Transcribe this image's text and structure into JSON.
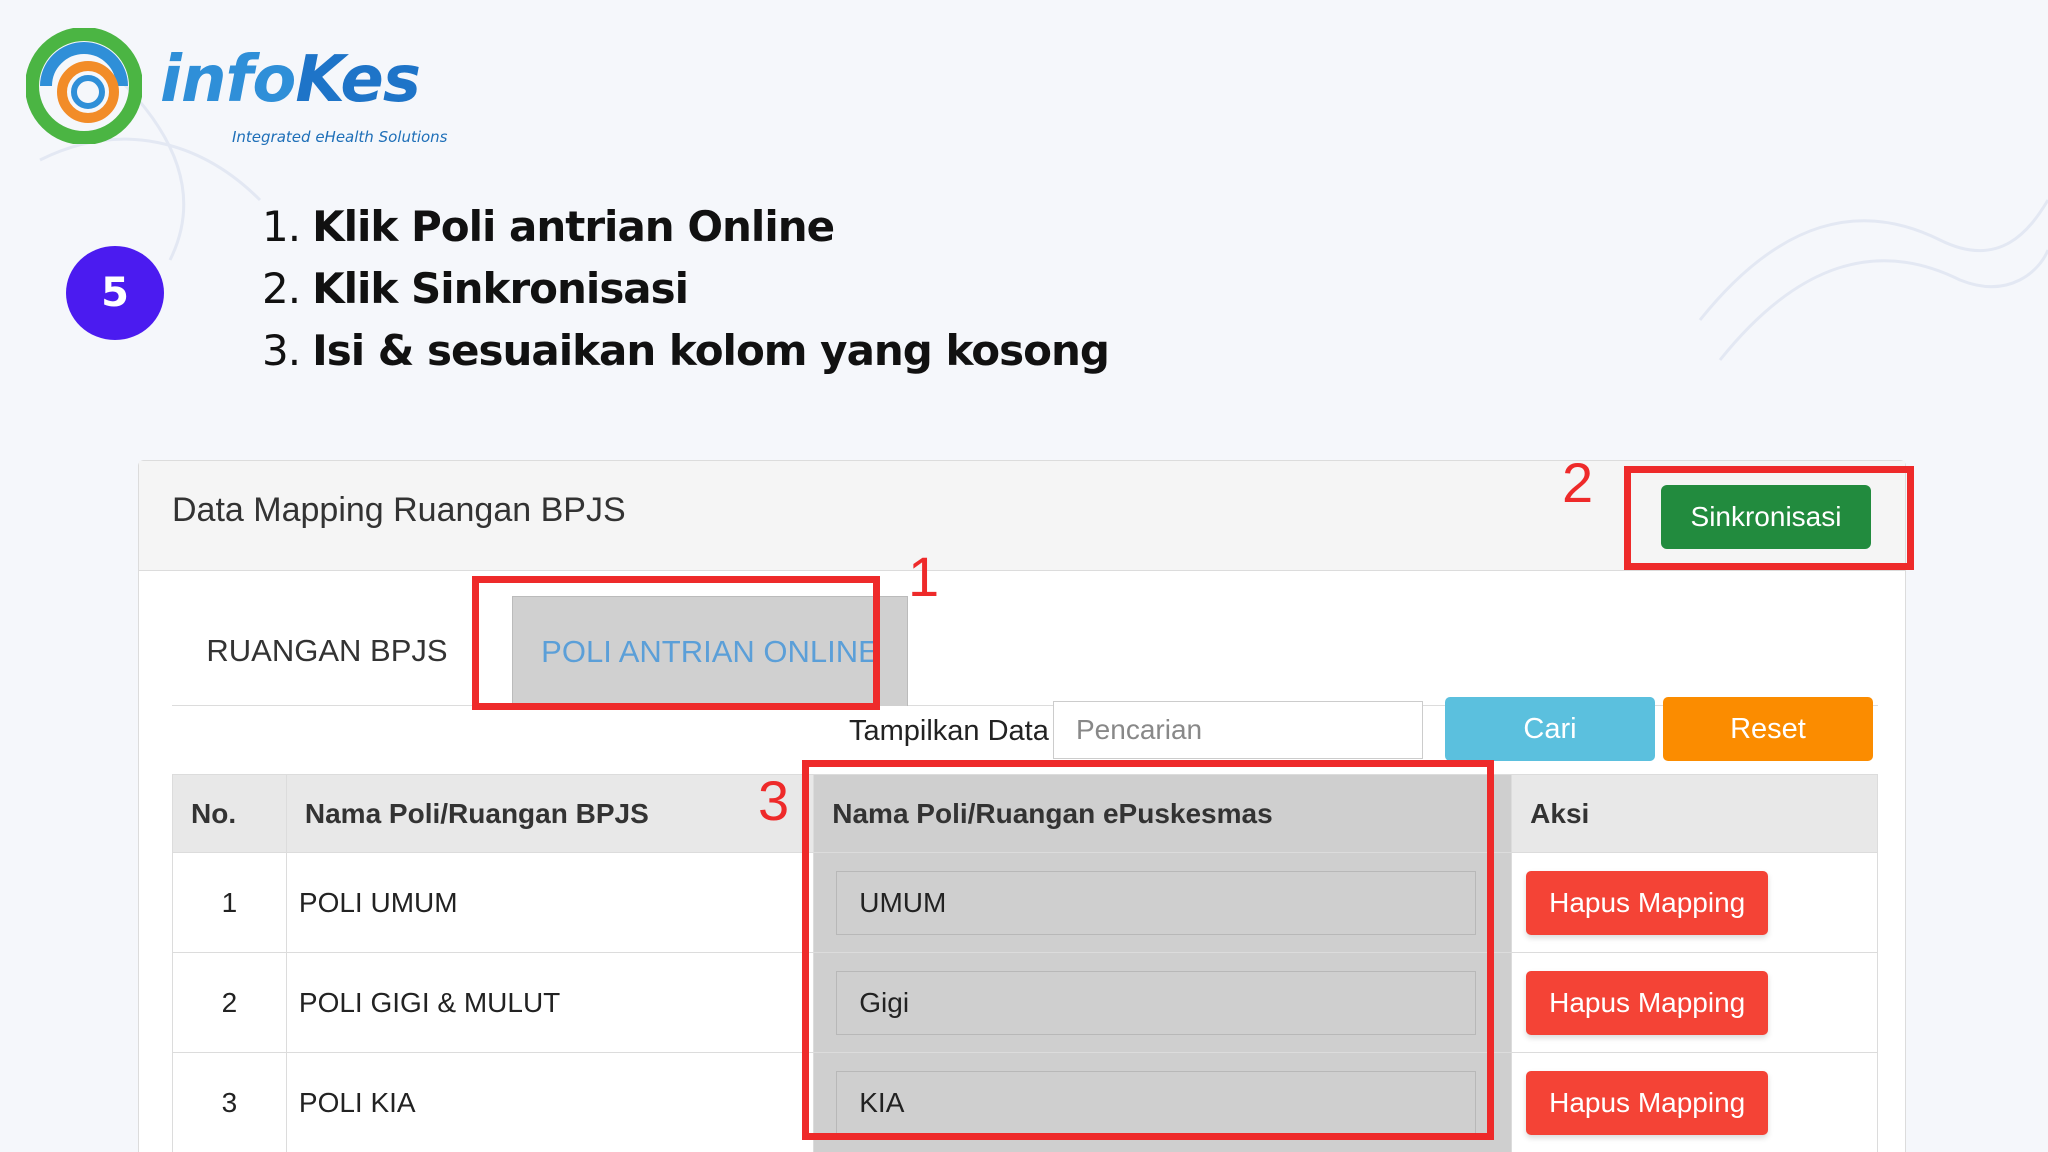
{
  "logo": {
    "word_part1": "info",
    "word_part2": "Kes",
    "tagline": "Integrated eHealth Solutions"
  },
  "step": {
    "number": "5"
  },
  "instructions": [
    {
      "num": "1.",
      "text": "Klik Poli antrian Online"
    },
    {
      "num": "2.",
      "text": "Klik Sinkronisasi"
    },
    {
      "num": "3.",
      "text": "Isi & sesuaikan kolom yang kosong"
    }
  ],
  "panel": {
    "title": "Data Mapping Ruangan BPJS",
    "sync_button": "Sinkronisasi"
  },
  "tabs": [
    {
      "label": "RUANGAN BPJS",
      "active": false
    },
    {
      "label": "POLI ANTRIAN ONLINE",
      "active": true
    }
  ],
  "filter": {
    "label": "Tampilkan Data",
    "placeholder": "Pencarian",
    "search_button": "Cari",
    "reset_button": "Reset"
  },
  "table": {
    "headers": [
      "No.",
      "Nama Poli/Ruangan BPJS",
      "Nama Poli/Ruangan ePuskesmas",
      "Aksi"
    ],
    "rows": [
      {
        "no": "1",
        "bpjs": "POLI UMUM",
        "epuskesmas": "UMUM",
        "action": "Hapus Mapping"
      },
      {
        "no": "2",
        "bpjs": "POLI GIGI & MULUT",
        "epuskesmas": "Gigi",
        "action": "Hapus Mapping"
      },
      {
        "no": "3",
        "bpjs": "POLI KIA",
        "epuskesmas": "KIA",
        "action": "Hapus Mapping"
      }
    ]
  },
  "annotations": [
    "1",
    "2",
    "3"
  ],
  "colors": {
    "accent_purple": "#4b1bf0",
    "annotation_red": "#ee2a2a",
    "sync_green": "#228b3e",
    "search_blue": "#5bc0de",
    "reset_orange": "#fb8c00",
    "delete_red": "#f44336"
  }
}
